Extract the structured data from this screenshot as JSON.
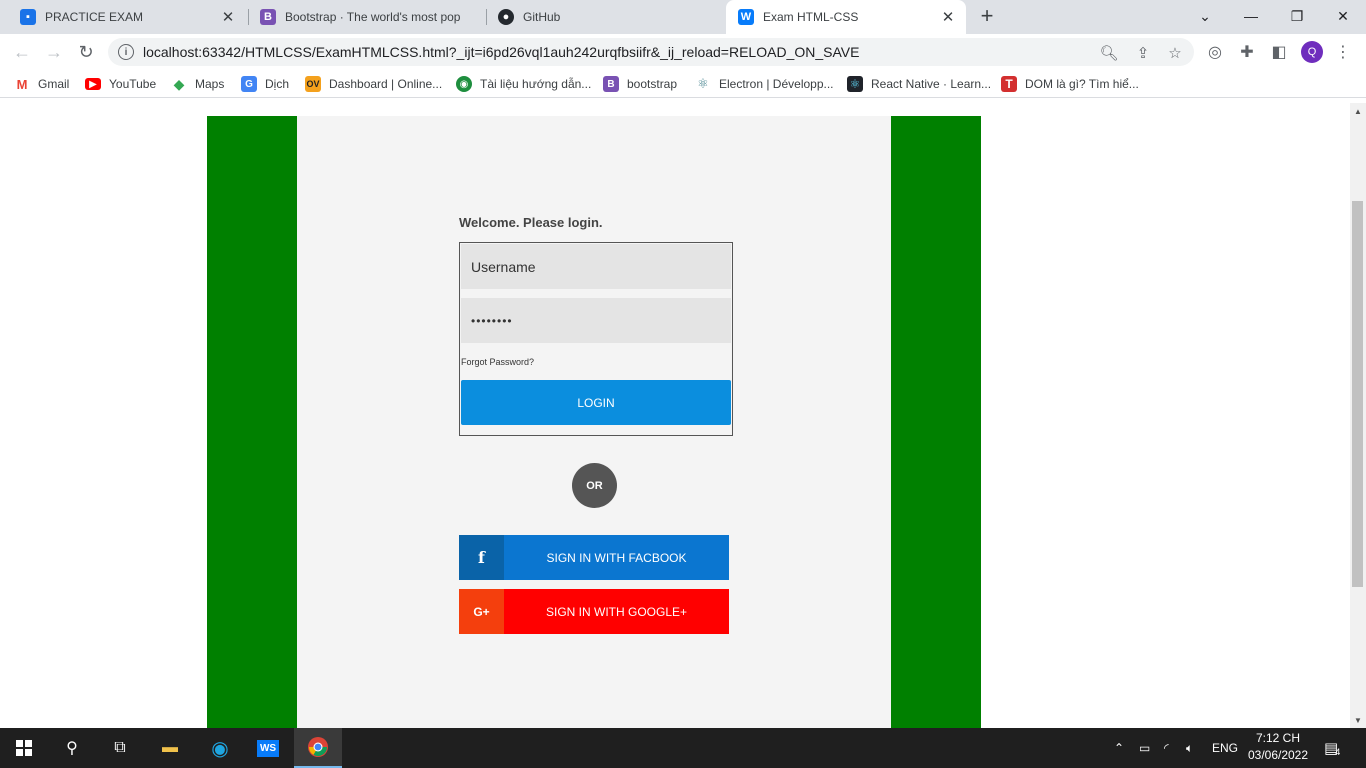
{
  "browser": {
    "tabs": [
      {
        "title": "PRACTICE EXAM",
        "favicon": "classroom-icon",
        "color": "#1a73e8"
      },
      {
        "title": "Bootstrap · The world's most pop",
        "favicon": "bootstrap-icon",
        "color": "#7952b3"
      },
      {
        "title": "GitHub",
        "favicon": "github-icon",
        "color": "#000000"
      },
      {
        "title": "Exam HTML-CSS",
        "favicon": "webstorm-icon",
        "color": "#087cfa",
        "active": true
      }
    ],
    "url": "localhost:63342/HTMLCSS/ExamHTMLCSS.html?_ijt=i6pd26vql1auh242urqfbsiifr&_ij_reload=RELOAD_ON_SAVE",
    "profile_initial": "Q",
    "bookmarks": [
      {
        "label": "Gmail",
        "icon": "gmail-icon"
      },
      {
        "label": "YouTube",
        "icon": "youtube-icon"
      },
      {
        "label": "Maps",
        "icon": "maps-icon"
      },
      {
        "label": "Dịch",
        "icon": "translate-icon"
      },
      {
        "label": "Dashboard | Online...",
        "icon": "ov-icon"
      },
      {
        "label": "Tài liệu hướng dẫn...",
        "icon": "globe-icon"
      },
      {
        "label": "bootstrap",
        "icon": "bootstrap-icon"
      },
      {
        "label": "Electron | Développ...",
        "icon": "electron-icon"
      },
      {
        "label": "React Native · Learn...",
        "icon": "react-icon"
      },
      {
        "label": "DOM là gì? Tìm hiể...",
        "icon": "t-icon"
      }
    ]
  },
  "page": {
    "welcome": "Welcome. Please login.",
    "username_placeholder": "Username",
    "password_value": "••••••••",
    "forgot": "Forgot Password?",
    "login_label": "LOGIN",
    "or_label": "OR",
    "facebook_label": "SIGN IN WITH FACBOOK",
    "facebook_icon_glyph": "f",
    "google_label": "SIGN IN WITH GOOGLE+",
    "google_icon_glyph": "G+",
    "colors": {
      "side_bars": "#008000",
      "login_button": "#0b8ede",
      "facebook": "#0b76d0",
      "google": "#ff0000"
    }
  },
  "taskbar": {
    "language": "ENG",
    "time": "7:12 CH",
    "date": "03/06/2022",
    "notification_count": "4"
  }
}
